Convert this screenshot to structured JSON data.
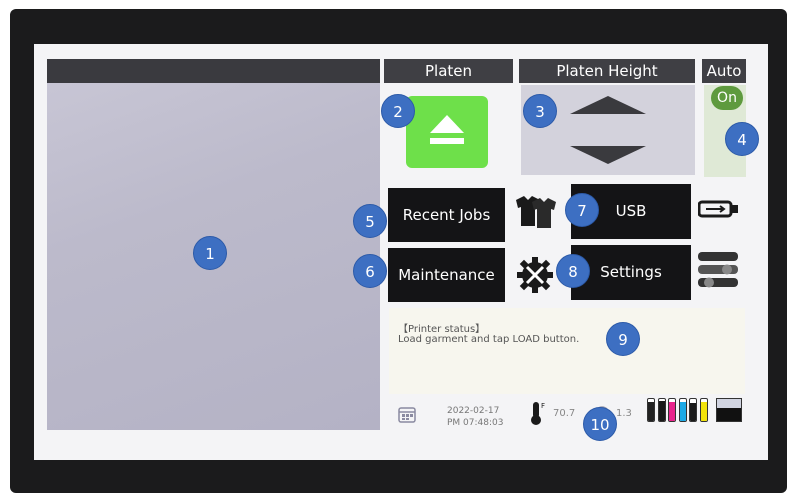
{
  "platen": {
    "tab_label": "Platen",
    "load_button_icon": "eject-icon"
  },
  "platen_height": {
    "tab_label": "Platen Height",
    "up_icon": "triangle-up-icon",
    "down_icon": "triangle-down-icon"
  },
  "auto": {
    "tab_label": "Auto",
    "toggle_label": "On"
  },
  "menu": {
    "recent_jobs": "Recent Jobs",
    "maintenance": "Maintenance",
    "usb": "USB",
    "settings": "Settings"
  },
  "status": {
    "title": "【Printer status】",
    "message": "Load garment and tap LOAD button."
  },
  "footer": {
    "date": "2022-02-17",
    "time": "PM 07:48:03",
    "temperature": "70.7",
    "humidity": "1.3"
  },
  "ink": {
    "levels": [
      {
        "color": "#222222",
        "level": 0.85
      },
      {
        "color": "#1a1a1a",
        "level": 0.9
      },
      {
        "color": "#e8248c",
        "level": 0.85
      },
      {
        "color": "#1ca9e6",
        "level": 0.85
      },
      {
        "color": "#1a1a1a",
        "level": 0.8
      },
      {
        "color": "#f2e30b",
        "level": 0.85
      }
    ],
    "white_level": 0.6
  },
  "markers": [
    "1",
    "2",
    "3",
    "4",
    "5",
    "6",
    "7",
    "8",
    "9",
    "10"
  ],
  "colors": {
    "accent_green": "#6ee04a",
    "toggle_green": "#5e9a3e",
    "marker_blue": "#3d6fc2",
    "button_dark": "#141416"
  }
}
